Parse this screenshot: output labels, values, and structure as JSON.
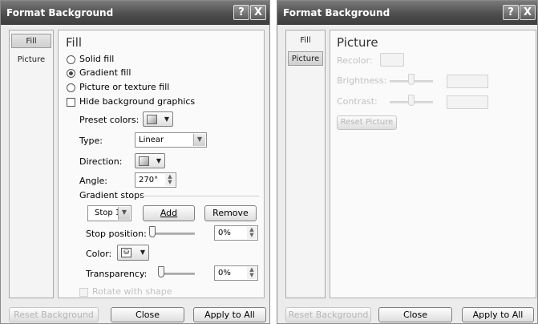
{
  "left_dialog": {
    "title": "Format Background",
    "help_icon": "?",
    "close_icon": "X",
    "sidebar": {
      "items": [
        {
          "label": "Fill"
        },
        {
          "label": "Picture"
        }
      ]
    },
    "panel_title": "Fill",
    "fill_options": [
      {
        "label": "Solid fill",
        "selected": false
      },
      {
        "label": "Gradient fill",
        "selected": true
      },
      {
        "label": "Picture or texture fill",
        "selected": false
      }
    ],
    "hide_background": {
      "label": "Hide background graphics",
      "checked": false
    },
    "preset_colors_label": "Preset colors:",
    "type_label": "Type:",
    "type_value": "Linear",
    "direction_label": "Direction:",
    "angle_label": "Angle:",
    "angle_value": "270°",
    "gradient_stops_label": "Gradient stops",
    "stop_select_value": "Stop 1",
    "add_button": "Add",
    "remove_button": "Remove",
    "stop_position_label": "Stop position:",
    "stop_position_value": "0%",
    "color_label": "Color:",
    "transparency_label": "Transparency:",
    "transparency_value": "0%",
    "rotate_label": "Rotate with shape",
    "reset_button": "Reset Background",
    "close_button": "Close",
    "apply_button": "Apply to All"
  },
  "right_dialog": {
    "title": "Format Background",
    "help_icon": "?",
    "close_icon": "X",
    "sidebar": {
      "items": [
        {
          "label": "Fill"
        },
        {
          "label": "Picture"
        }
      ]
    },
    "panel_title": "Picture",
    "recolor_label": "Recolor:",
    "brightness_label": "Brightness:",
    "contrast_label": "Contrast:",
    "reset_picture_button": "Reset Picture",
    "reset_button": "Reset Background",
    "close_button": "Close",
    "apply_button": "Apply to All"
  },
  "colors": {
    "titlebar": "#4e4e4e",
    "dialog_bg": "#ececec",
    "panel_bg": "#fafafa"
  },
  "icons": [
    "help-icon",
    "close-icon",
    "color-swatch-icon",
    "dropdown-arrow-icon",
    "spin-arrows-icon",
    "paint-bucket-icon"
  ]
}
